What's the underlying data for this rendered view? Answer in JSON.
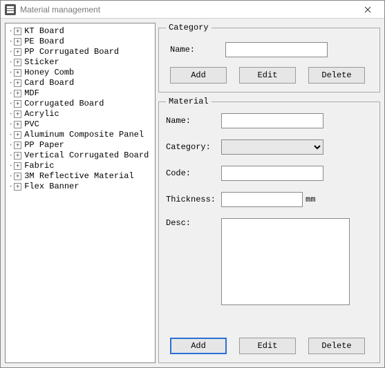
{
  "window": {
    "title": "Material management"
  },
  "tree": {
    "items": [
      "KT Board",
      "PE Board",
      "PP Corrugated Board",
      "Sticker",
      "Honey Comb",
      "Card Board",
      "MDF",
      "Corrugated Board",
      "Acrylic",
      "PVC",
      "Aluminum Composite Panel",
      "PP Paper",
      "Vertical Corrugated Board",
      "Fabric",
      "3M Reflective Material",
      "Flex Banner"
    ]
  },
  "category": {
    "legend": "Category",
    "name_label": "Name:",
    "name_value": "",
    "add_label": "Add",
    "edit_label": "Edit",
    "delete_label": "Delete"
  },
  "material": {
    "legend": "Material",
    "name_label": "Name:",
    "name_value": "",
    "category_label": "Category:",
    "category_value": "",
    "code_label": "Code:",
    "code_value": "",
    "thickness_label": "Thickness:",
    "thickness_value": "",
    "thickness_unit": "mm",
    "desc_label": "Desc:",
    "desc_value": "",
    "add_label": "Add",
    "edit_label": "Edit",
    "delete_label": "Delete"
  }
}
